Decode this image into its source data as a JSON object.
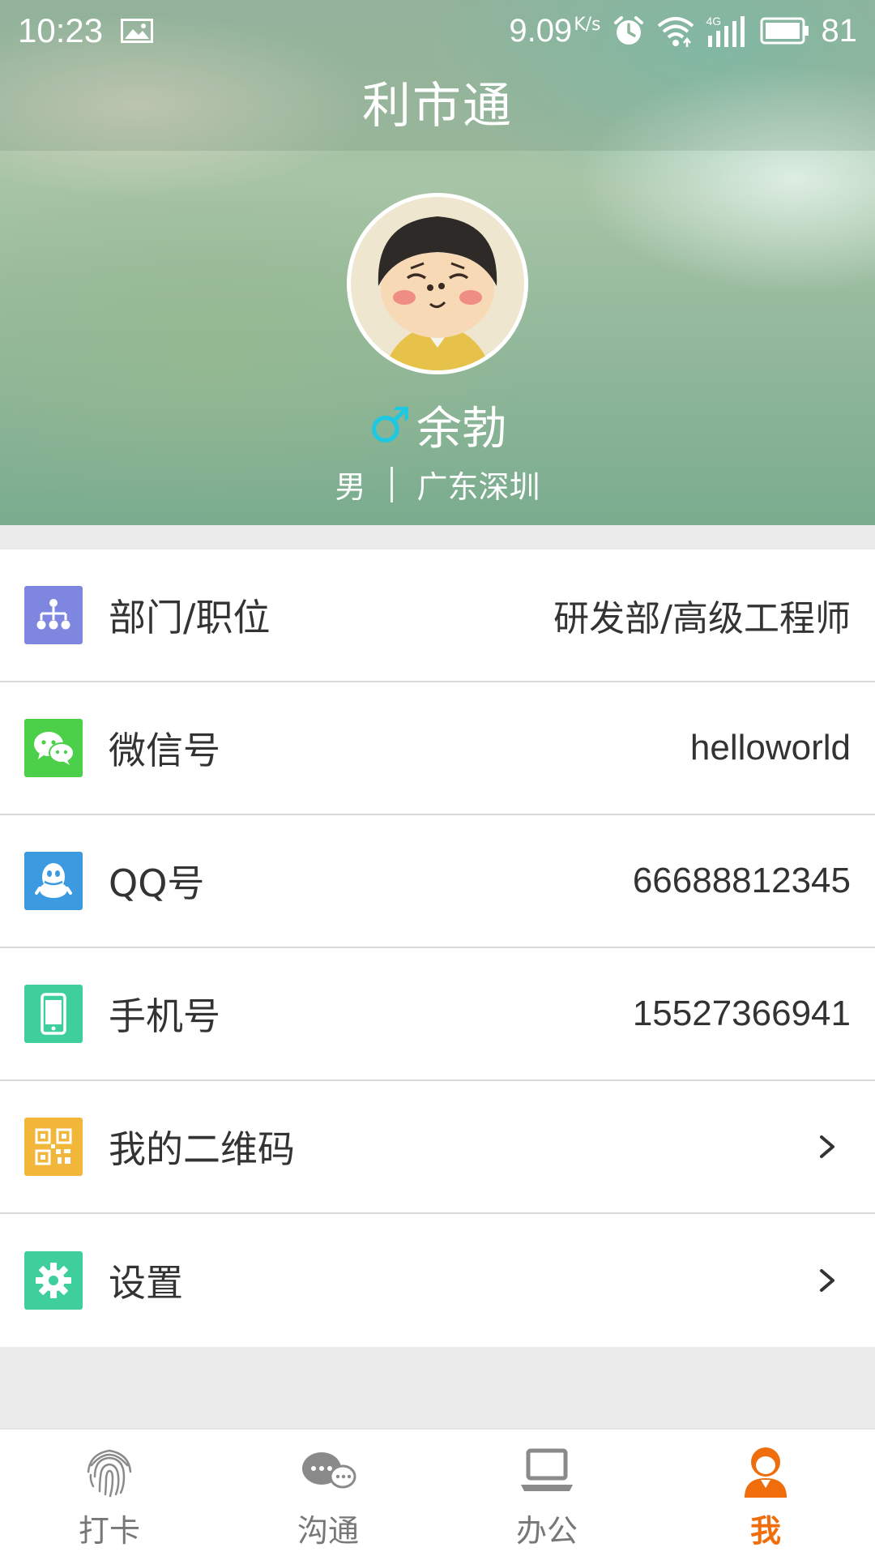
{
  "status_bar": {
    "time": "10:23",
    "net_speed": "9.09",
    "net_speed_unit": "K/s",
    "network_type": "4G",
    "battery_level": "81"
  },
  "app": {
    "title": "利市通"
  },
  "profile": {
    "gender_symbol": "♂",
    "name": "余勃",
    "gender": "男",
    "location": "广东深圳"
  },
  "info_rows": [
    {
      "label": "部门/职位",
      "value": "研发部/高级工程师",
      "icon": "org-chart-icon",
      "color": "#7f86e0"
    },
    {
      "label": "微信号",
      "value": "helloworld",
      "icon": "wechat-icon",
      "color": "#4cd04a"
    },
    {
      "label": "QQ号",
      "value": "66688812345",
      "icon": "qq-icon",
      "color": "#3b9ae0"
    },
    {
      "label": "手机号",
      "value": "15527366941",
      "icon": "phone-icon",
      "color": "#3ecf9d"
    },
    {
      "label": "我的二维码",
      "icon": "qr-code-icon",
      "color": "#f2b73a"
    },
    {
      "label": "设置",
      "icon": "gear-icon",
      "color": "#3ecf9d"
    }
  ],
  "tabs": [
    {
      "label": "打卡",
      "icon": "fingerprint-icon",
      "active": false
    },
    {
      "label": "沟通",
      "icon": "chat-bubbles-icon",
      "active": false
    },
    {
      "label": "办公",
      "icon": "laptop-icon",
      "active": false
    },
    {
      "label": "我",
      "icon": "user-profile-icon",
      "active": true
    }
  ],
  "colors": {
    "accent": "#f06d0c",
    "gender_male": "#1ec8e0",
    "page_background": "#ebebeb"
  }
}
